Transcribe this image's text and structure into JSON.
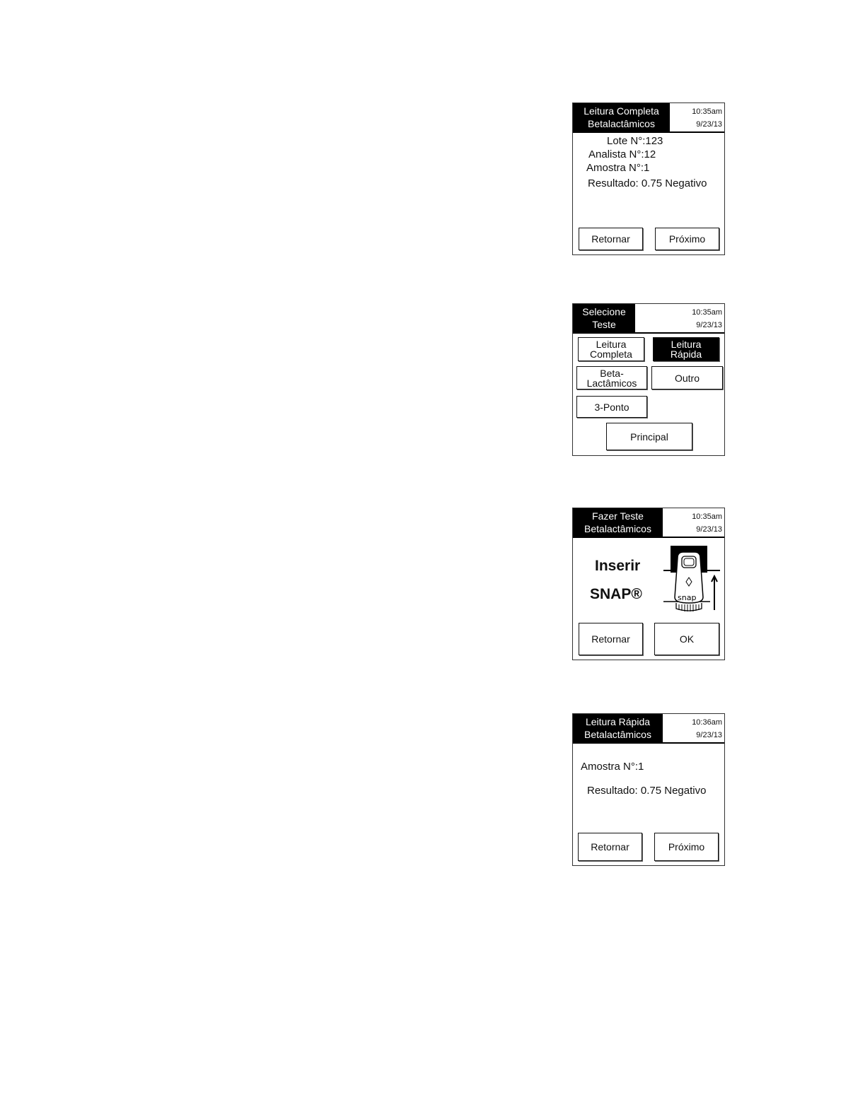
{
  "screen1": {
    "title_line1": "Leitura Completa",
    "title_line2": "Betalactâmicos",
    "time": "10:35am",
    "date": "9/23/13",
    "lote": "Lote N°:123",
    "analista": "Analista N°:12",
    "amostra": "Amostra N°:1",
    "resultado": "Resultado: 0.75 Negativo",
    "btn_back": "Retornar",
    "btn_next": "Próximo"
  },
  "screen2": {
    "title_line1": "Selecione",
    "title_line2": "Teste",
    "time": "10:35am",
    "date": "9/23/13",
    "btn_completa_1": "Leitura",
    "btn_completa_2": "Completa",
    "btn_rapida_1": "Leitura",
    "btn_rapida_2": "Rápida",
    "btn_beta_1": "Beta-",
    "btn_beta_2": "Lactâmicos",
    "btn_outro": "Outro",
    "btn_3ponto": "3-Ponto",
    "btn_principal": "Principal"
  },
  "screen3": {
    "title_line1": "Fazer Teste",
    "title_line2": "Betalactâmicos",
    "time": "10:35am",
    "date": "9/23/13",
    "inserir": "Inserir",
    "snap": "SNAP®",
    "device_label": "snap",
    "btn_back": "Retornar",
    "btn_ok": "OK"
  },
  "screen4": {
    "title_line1": "Leitura Rápida",
    "title_line2": "Betalactâmicos",
    "time": "10:36am",
    "date": "9/23/13",
    "amostra": "Amostra N°:1",
    "resultado": "Resultado: 0.75 Negativo",
    "btn_back": "Retornar",
    "btn_next": "Próximo"
  }
}
